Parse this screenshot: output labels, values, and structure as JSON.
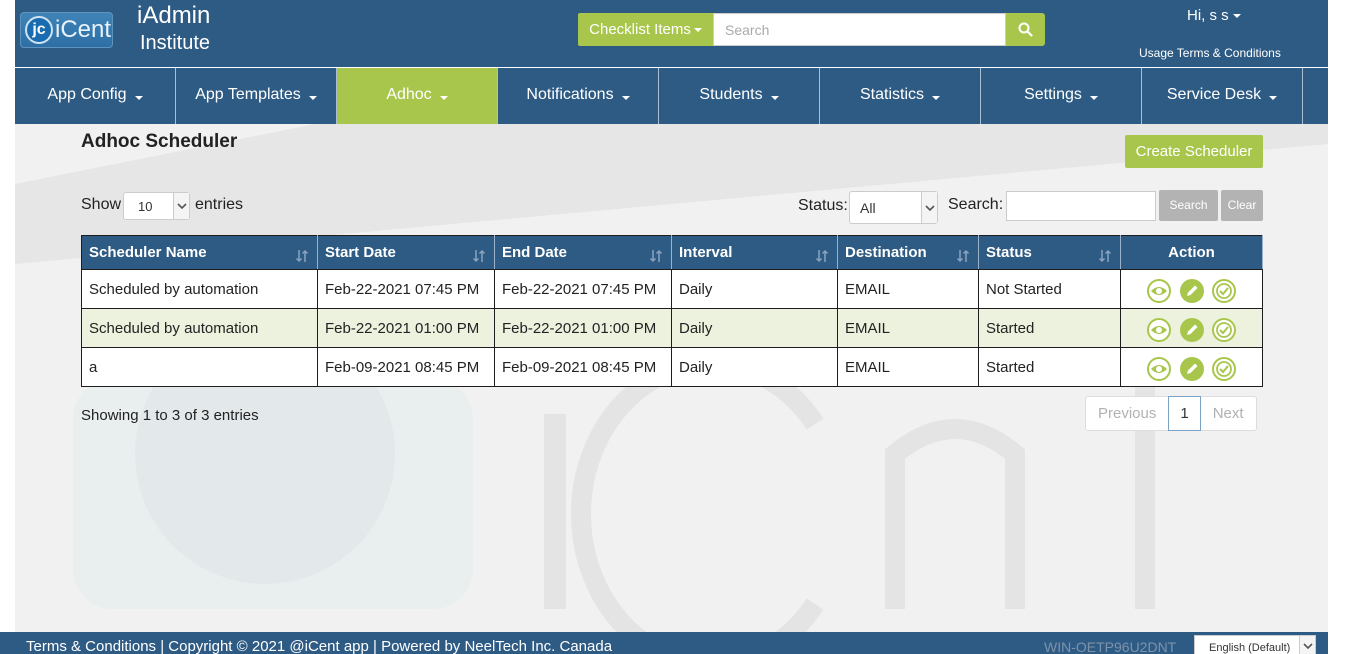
{
  "header": {
    "logo_text": "iCent",
    "logo_mark": "jc",
    "brand_title": "iAdmin",
    "brand_subtitle": "Institute",
    "checklist_label": "Checklist Items",
    "search_placeholder": "Search",
    "user_greeting": "Hi, s s",
    "usage_link": "Usage Terms & Conditions"
  },
  "nav": {
    "items": [
      {
        "label": "App Config"
      },
      {
        "label": "App Templates"
      },
      {
        "label": "Adhoc",
        "active": true
      },
      {
        "label": "Notifications"
      },
      {
        "label": "Students"
      },
      {
        "label": "Statistics"
      },
      {
        "label": "Settings"
      },
      {
        "label": "Service Desk"
      }
    ]
  },
  "main": {
    "title": "Adhoc Scheduler",
    "create_button": "Create Scheduler",
    "show_label": "Show",
    "entries_value": "10",
    "entries_label": "entries",
    "status_label": "Status:",
    "status_value": "All",
    "search_label": "Search:",
    "search_button": "Search",
    "clear_button": "Clear",
    "info_text": "Showing 1 to 3 of 3 entries",
    "pager": {
      "previous": "Previous",
      "current": "1",
      "next": "Next"
    }
  },
  "table": {
    "columns": [
      "Scheduler Name",
      "Start Date",
      "End Date",
      "Interval",
      "Destination",
      "Status",
      "Action"
    ],
    "rows": [
      [
        "Scheduled by automation",
        "Feb-22-2021 07:45 PM",
        "Feb-22-2021 07:45 PM",
        "Daily",
        "EMAIL",
        "Not Started"
      ],
      [
        "Scheduled by automation",
        "Feb-22-2021 01:00 PM",
        "Feb-22-2021 01:00 PM",
        "Daily",
        "EMAIL",
        "Started"
      ],
      [
        "a",
        "Feb-09-2021 08:45 PM",
        "Feb-09-2021 08:45 PM",
        "Daily",
        "EMAIL",
        "Started"
      ]
    ]
  },
  "footer": {
    "text": "Terms & Conditions | Copyright © 2021 @iCent app | Powered by NeelTech Inc. Canada",
    "machine_name": "WIN-OETP96U2DNT",
    "language": "English (Default)"
  },
  "colors": {
    "primary": "#2e5b84",
    "accent": "#a8c64b",
    "row_alt": "#ecf2de",
    "content_bg": "#f1f1f1"
  },
  "icons": [
    "search-icon",
    "eye-icon",
    "pencil-icon",
    "check-circle-icon",
    "sort-icon",
    "chevron-down-icon"
  ]
}
